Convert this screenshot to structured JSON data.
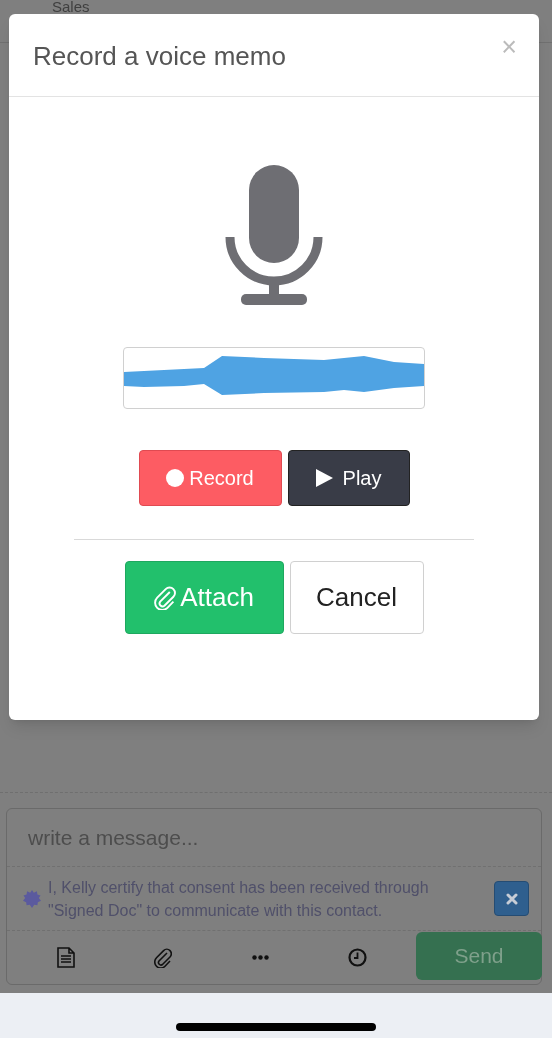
{
  "background_page": {
    "heading": "Sales"
  },
  "modal": {
    "title": "Record a voice memo",
    "close": "×",
    "buttons": [
      {
        "kind": "record",
        "label": "Record"
      },
      {
        "kind": "play",
        "label": "Play"
      }
    ],
    "actions": [
      {
        "kind": "attach",
        "label": "Attach"
      },
      {
        "kind": "cancel",
        "label": "Cancel"
      }
    ]
  },
  "composer": {
    "placeholder": "write a message...",
    "consent_text": "I, Kelly certify that consent has been received through \"Signed Doc\" to communicate with this contact.",
    "send": "Send"
  }
}
